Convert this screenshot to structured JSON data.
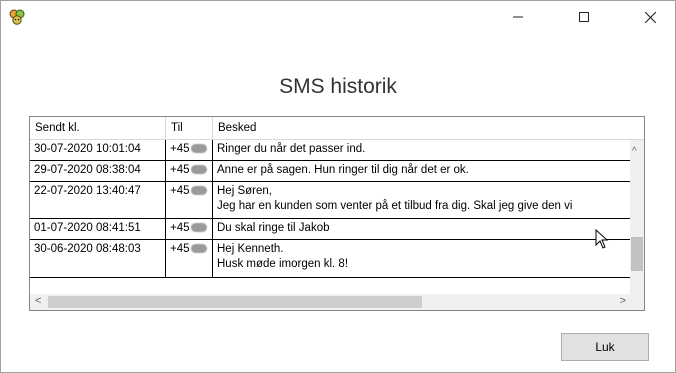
{
  "window": {
    "title_icon": "app-logo-icon",
    "controls": {
      "minimize": "minimize-icon",
      "maximize": "maximize-icon",
      "close": "close-icon"
    }
  },
  "dialog_title": "SMS historik",
  "table": {
    "columns": [
      "Sendt kl.",
      "Til",
      "Besked"
    ],
    "rows": [
      {
        "sent": "30-07-2020 10:01:04",
        "to": "+45",
        "message": [
          "Ringer du når det passer ind."
        ]
      },
      {
        "sent": "29-07-2020 08:38:04",
        "to": "+45",
        "message": [
          "Anne er på sagen. Hun ringer til dig når det er ok."
        ]
      },
      {
        "sent": "22-07-2020 13:40:47",
        "to": "+45",
        "message": [
          "Hej Søren,",
          "Jeg har en kunden som venter på et tilbud fra dig. Skal jeg give den vi"
        ]
      },
      {
        "sent": "01-07-2020 08:41:51",
        "to": "+45",
        "message": [
          "Du skal ringe til Jakob"
        ]
      },
      {
        "sent": "30-06-2020 08:48:03",
        "to": "+45",
        "message": [
          "Hej Kenneth.",
          "Husk møde imorgen kl. 8!"
        ]
      }
    ]
  },
  "scroll": {
    "up": "^",
    "left": "<",
    "right": ">"
  },
  "buttons": {
    "close_label": "Luk"
  },
  "colors": {
    "button_bg": "#e1e1e1",
    "scrollbar_thumb": "#c2c2c2"
  }
}
